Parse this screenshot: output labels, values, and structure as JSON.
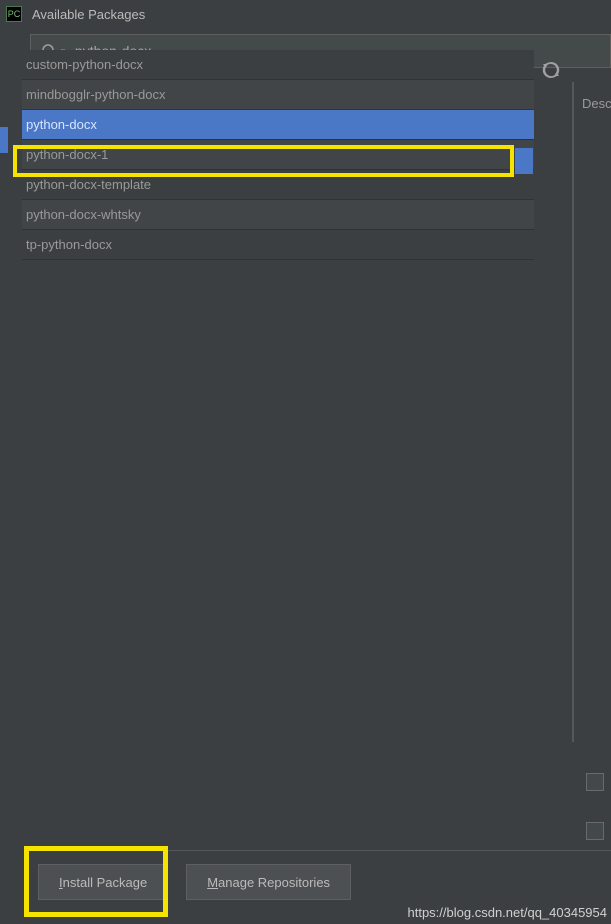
{
  "window": {
    "title": "Available Packages",
    "app_icon_text": "PC"
  },
  "search": {
    "value": "python-docx"
  },
  "packages": {
    "items": [
      {
        "name": "custom-python-docx"
      },
      {
        "name": "mindbogglr-python-docx"
      },
      {
        "name": "python-docx"
      },
      {
        "name": "python-docx-1"
      },
      {
        "name": "python-docx-template"
      },
      {
        "name": "python-docx-whtsky"
      },
      {
        "name": "tp-python-docx"
      }
    ]
  },
  "side": {
    "description_label": "Descr"
  },
  "buttons": {
    "install_prefix": "I",
    "install_rest": "nstall Package",
    "manage_prefix": "M",
    "manage_rest": "anage Repositories"
  },
  "watermark": "https://blog.csdn.net/qq_40345954"
}
